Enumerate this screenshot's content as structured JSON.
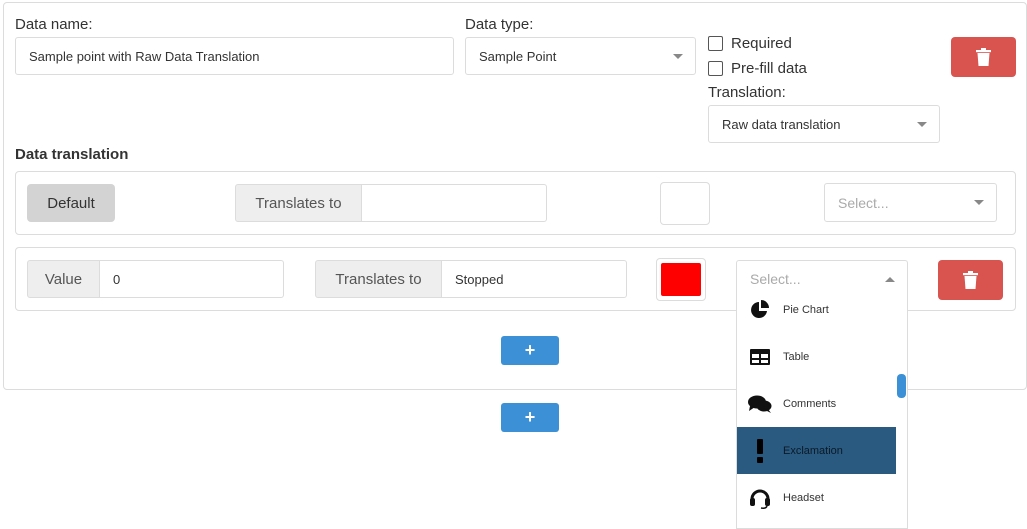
{
  "form": {
    "data_name_label": "Data name:",
    "data_name_value": "Sample point with Raw Data Translation",
    "data_type_label": "Data type:",
    "data_type_value": "Sample Point",
    "required_label": "Required",
    "prefill_label": "Pre-fill data",
    "translation_label": "Translation:",
    "translation_value": "Raw data translation"
  },
  "data_translation": {
    "heading": "Data translation",
    "default_row": {
      "default_label": "Default",
      "translates_label": "Translates to",
      "translates_value": "",
      "icon_placeholder": "Select..."
    },
    "value_row": {
      "value_label": "Value",
      "value": "0",
      "translates_label": "Translates to",
      "translates_value": "Stopped",
      "color": "#ff0000",
      "icon_placeholder": "Select..."
    },
    "icon_options": [
      {
        "label": "Pie Chart",
        "icon": "pie-chart-icon"
      },
      {
        "label": "Table",
        "icon": "table-icon"
      },
      {
        "label": "Comments",
        "icon": "comments-icon"
      },
      {
        "label": "Exclamation",
        "icon": "exclamation-icon",
        "highlighted": true
      },
      {
        "label": "Headset",
        "icon": "headset-icon"
      }
    ]
  },
  "buttons": {
    "add_symbol": "+"
  },
  "colors": {
    "danger": "#d9534f",
    "primary": "#3c91d6",
    "highlight": "#2a5a80",
    "swatch": "#ff0000"
  }
}
